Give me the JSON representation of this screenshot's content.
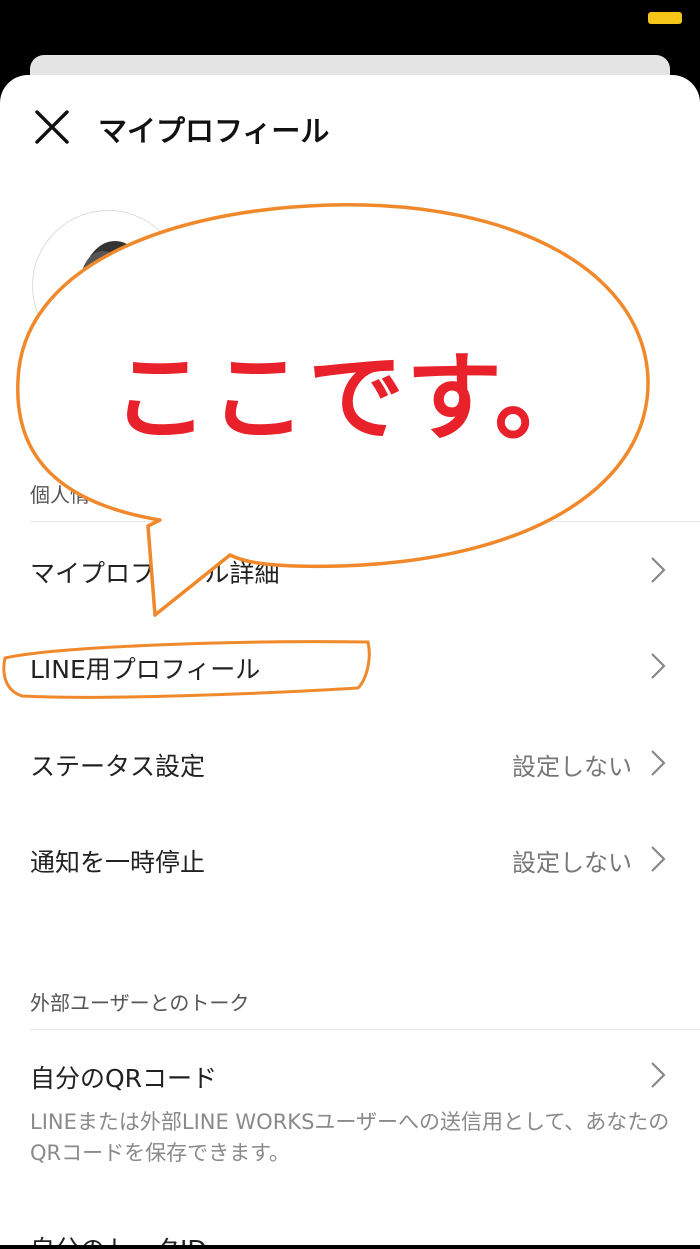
{
  "header": {
    "title": "マイプロフィール"
  },
  "sections": {
    "personal": {
      "label": "個人情報"
    },
    "external": {
      "label": "外部ユーザーとのトーク"
    }
  },
  "rows": {
    "profile_detail": {
      "label": "マイプロフィール詳細"
    },
    "line_profile": {
      "label": "LINE用プロフィール"
    },
    "status": {
      "label": "ステータス設定",
      "value": "設定しない"
    },
    "notify_pause": {
      "label": "通知を一時停止",
      "value": "設定しない"
    },
    "qr_code": {
      "label": "自分のQRコード",
      "desc": "LINEまたは外部LINE WORKSユーザーへの送信用として、あなたのQRコードを保存できます。"
    },
    "talk_id": {
      "label": "自分のトークID"
    }
  },
  "annotation": {
    "text": "ここです。",
    "color": "#e8212a",
    "outline": "#f0892b"
  }
}
